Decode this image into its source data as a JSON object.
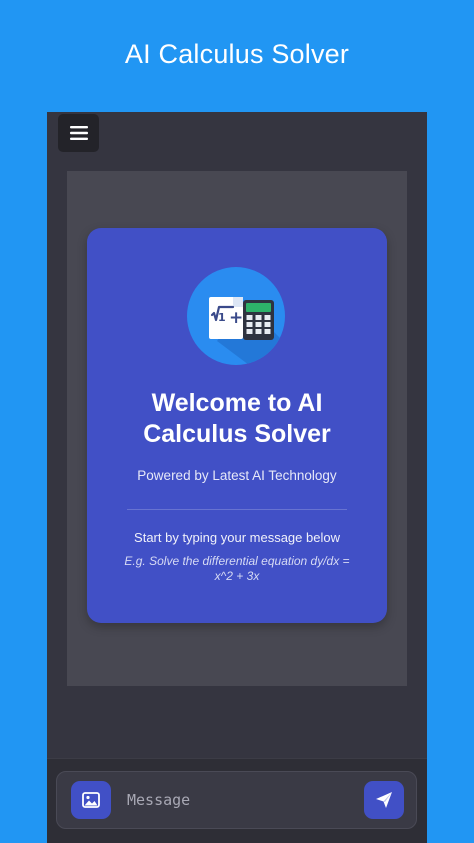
{
  "app": {
    "title": "AI Calculus Solver"
  },
  "welcome": {
    "heading": "Welcome to AI Calculus Solver",
    "subtitle": "Powered by Latest AI Technology",
    "hint": "Start by typing your message below",
    "example": "E.g. Solve the differential equation dy/dx = x^2 + 3x"
  },
  "input": {
    "placeholder": "Message"
  },
  "icons": {
    "menu": "hamburger-menu-icon",
    "logo": "calculator-math-icon",
    "attach": "image-icon",
    "send": "send-icon"
  },
  "colors": {
    "header_bg": "#2196F3",
    "screen_bg": "#353540",
    "card_bg": "#4150C6",
    "logo_bg": "#2A8CF0",
    "button_bg": "#4150C6",
    "calculator_screen": "#2DB36A"
  }
}
